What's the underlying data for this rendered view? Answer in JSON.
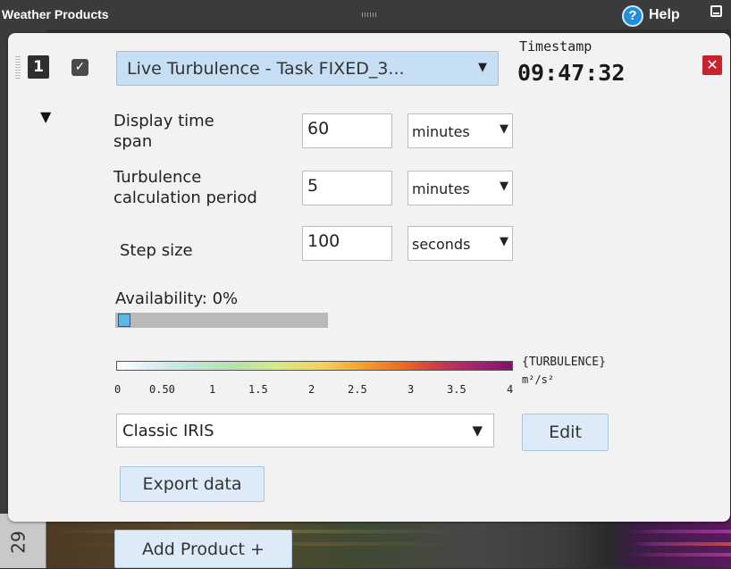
{
  "window": {
    "title": "Weather Products",
    "help_label": "Help",
    "help_icon": "?"
  },
  "product": {
    "index": "1",
    "checked": true,
    "name": "Live Turbulence - Task FIXED_3...",
    "timestamp_label": "Timestamp",
    "timestamp_value": "09:47:32",
    "close_symbol": "✕"
  },
  "settings": {
    "display_time_span": {
      "label_line1": "Display time",
      "label_line2": "span",
      "value": "60",
      "unit": "minutes"
    },
    "turbulence_period": {
      "label_line1": "Turbulence",
      "label_line2": "calculation period",
      "value": "5",
      "unit": "minutes"
    },
    "step_size": {
      "label": "Step size",
      "value": "100",
      "unit": "seconds"
    }
  },
  "availability": {
    "label": "Availability: 0%",
    "percent": 0
  },
  "colorbar": {
    "ticks": [
      "0",
      "0.50",
      "1",
      "1.5",
      "2",
      "2.5",
      "3",
      "3.5",
      "4"
    ],
    "name": "{TURBULENCE}",
    "unit": "m²/s²"
  },
  "palette": {
    "selected": "Classic IRIS",
    "edit_label": "Edit"
  },
  "export_label": "Export data",
  "add_product_label": "Add Product +",
  "background": {
    "ruler_label": "29"
  }
}
